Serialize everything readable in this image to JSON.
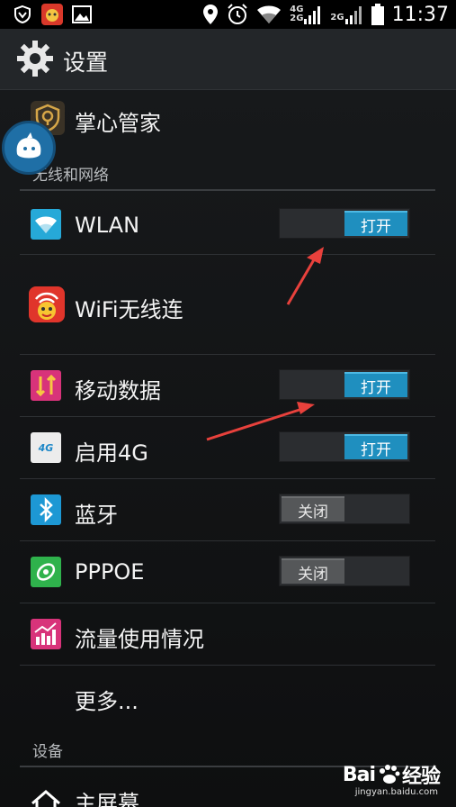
{
  "status_bar": {
    "time": "11:37",
    "net_top": "4G",
    "net_bottom": "2G",
    "net_secondary": "2G",
    "icons": [
      "shield-icon",
      "app-notification-icon",
      "image-icon",
      "location-icon",
      "alarm-icon",
      "wifi-icon",
      "signal-icon",
      "battery-icon"
    ]
  },
  "action_bar": {
    "title": "设置"
  },
  "items": {
    "guard": {
      "label": "掌心管家"
    },
    "wlan": {
      "label": "WLAN",
      "toggle": "打开"
    },
    "wifi_connect": {
      "label": "WiFi无线连"
    },
    "mobile_data": {
      "label": "移动数据",
      "toggle": "打开"
    },
    "enable_4g": {
      "label": "启用4G",
      "toggle": "打开",
      "badge": "4G"
    },
    "bluetooth": {
      "label": "蓝牙",
      "toggle": "关闭"
    },
    "pppoe": {
      "label": "PPPOE",
      "toggle": "关闭"
    },
    "data_usage": {
      "label": "流量使用情况"
    },
    "more": {
      "label": "更多..."
    },
    "home_screen": {
      "label": "主屏幕"
    }
  },
  "sections": {
    "wireless": "无线和网络",
    "device": "设备"
  },
  "watermark": {
    "logo_left": "Bai",
    "logo_right": "经验",
    "url": "jingyan.baidu.com"
  },
  "colors": {
    "accent": "#1f8fbf",
    "annotation_arrow": "#e8413c"
  }
}
